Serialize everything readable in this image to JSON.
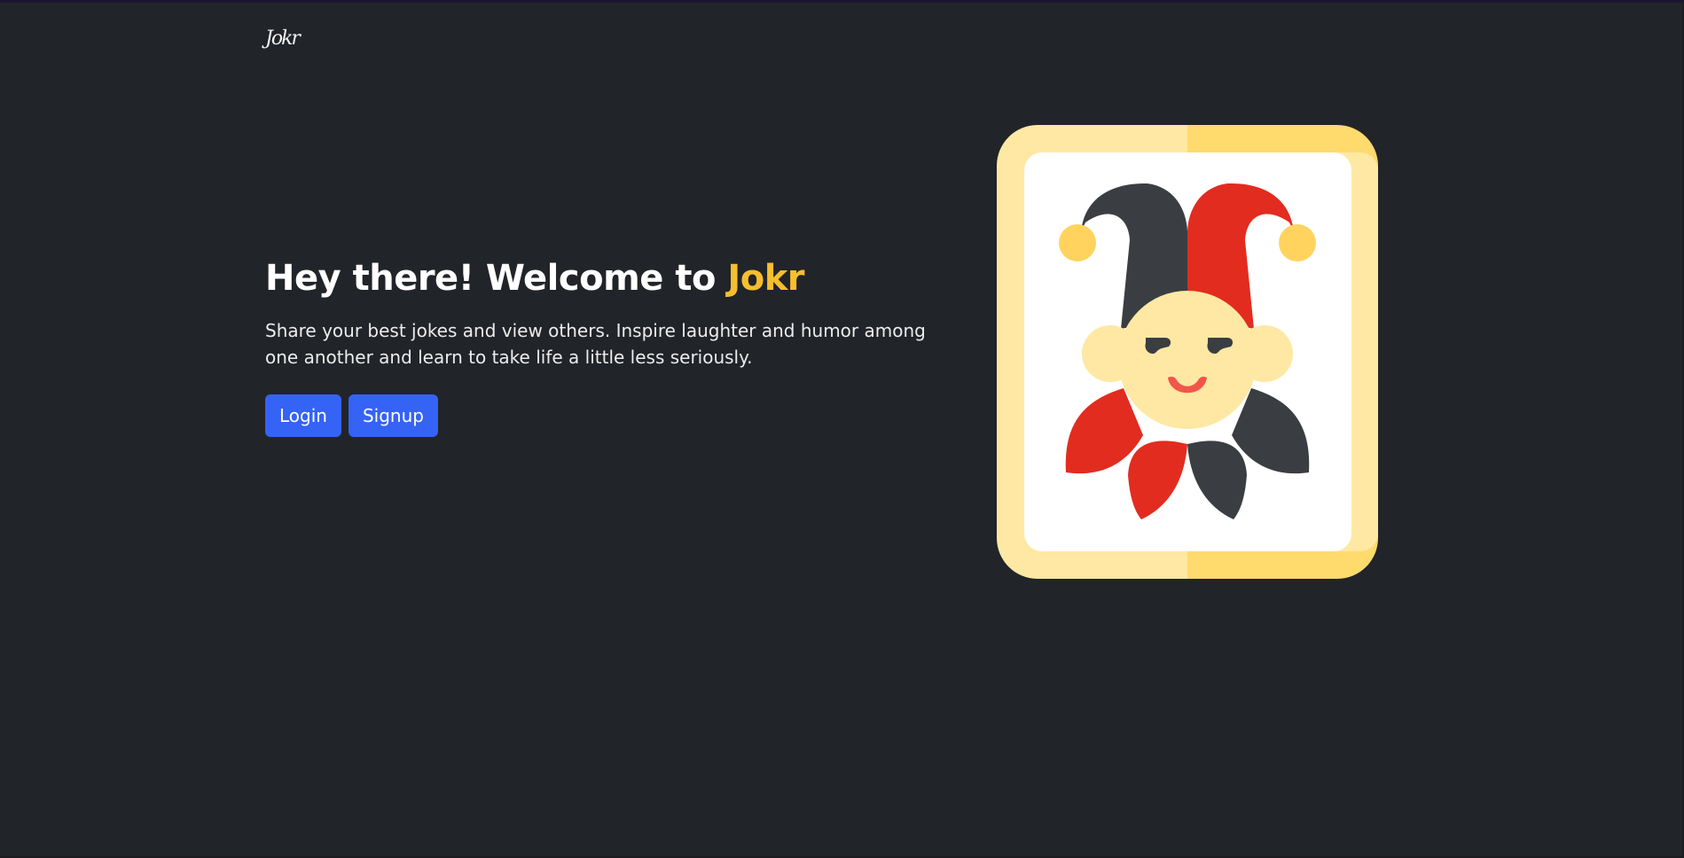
{
  "app": {
    "logo_text": "Jokr"
  },
  "hero": {
    "title_prefix": "Hey there! Welcome to ",
    "title_brand": "Jokr",
    "description": "Share your best jokes and view others. Inspire laughter and humor among one another and learn to take life a little less seriously."
  },
  "actions": {
    "login_label": "Login",
    "signup_label": "Signup"
  },
  "illustration": {
    "icon": "joker-card-icon"
  },
  "colors": {
    "background": "#212429",
    "brand_accent": "#f6be2e",
    "button": "#3563f5",
    "jester_red": "#e22c1f",
    "jester_dark": "#3a3e42",
    "card_light": "#fee8a3",
    "card_gold": "#ffda6d"
  }
}
